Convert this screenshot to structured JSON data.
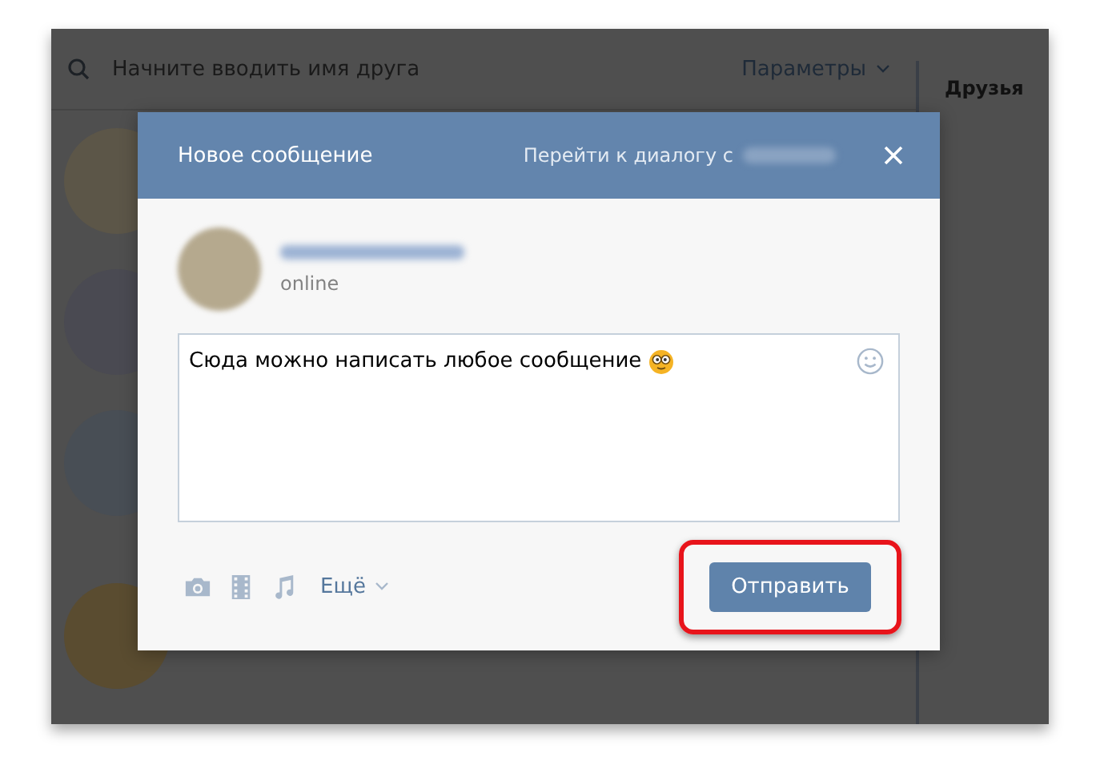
{
  "search": {
    "placeholder": "Начните вводить имя друга"
  },
  "filter": {
    "label": "Параметры"
  },
  "side_tab": {
    "label": "Друзья"
  },
  "dialog": {
    "title": "Новое сообщение",
    "goto_link": "Перейти к диалогу с",
    "recipient": {
      "status": "online"
    },
    "message": {
      "value": "Сюда можно написать любое сообщение"
    },
    "more": {
      "label": "Ещё"
    },
    "send_button": {
      "label": "Отправить",
      "highlighted": true
    }
  }
}
